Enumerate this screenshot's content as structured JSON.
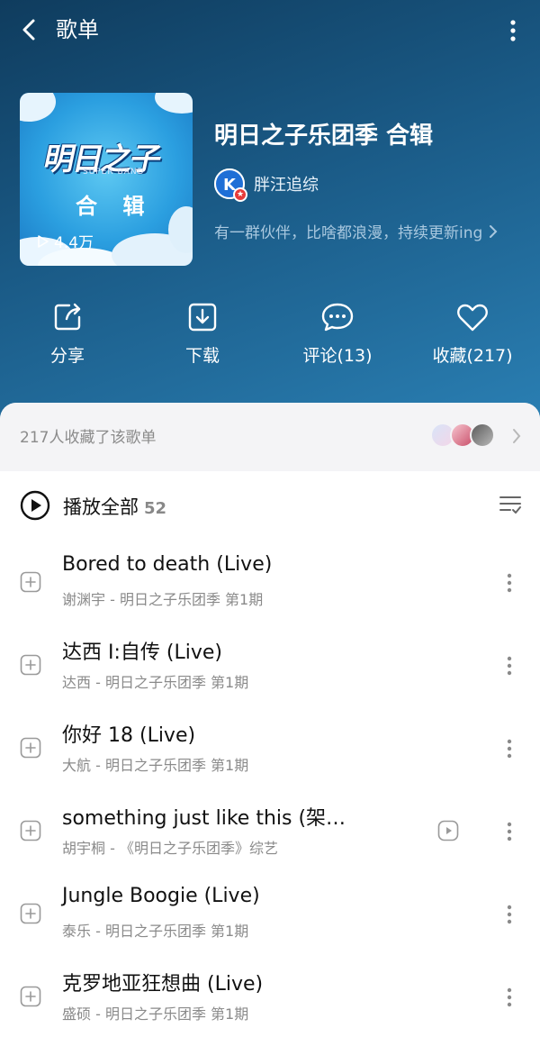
{
  "topbar": {
    "title": "歌单"
  },
  "playlist": {
    "title": "明日之子乐团季 合辑",
    "cover": {
      "logo_text": "明日之子",
      "sub_text": "SUPER BAND",
      "label": "合 辑",
      "plays": "4.4万"
    },
    "creator": {
      "avatar_letter": "K",
      "name": "胖汪追综"
    },
    "description": "有一群伙伴，比啥都浪漫，持续更新ing"
  },
  "actions": [
    {
      "id": "share",
      "label": "分享",
      "icon": "share-icon"
    },
    {
      "id": "download",
      "label": "下载",
      "icon": "download-icon"
    },
    {
      "id": "comment",
      "label": "评论(13)",
      "icon": "comment-icon"
    },
    {
      "id": "favorite",
      "label": "收藏(217)",
      "icon": "heart-icon"
    }
  ],
  "collectors": {
    "text": "217人收藏了该歌单"
  },
  "play_all": {
    "label": "播放全部",
    "count": "52"
  },
  "songs": [
    {
      "title": "Bored to death (Live)",
      "subtitle": "谢渊宇 - 明日之子乐团季 第1期",
      "has_video": false
    },
    {
      "title": "达西 I:自传 (Live)",
      "subtitle": "达西 - 明日之子乐团季 第1期",
      "has_video": false
    },
    {
      "title": "你好 18 (Live)",
      "subtitle": "大航 - 明日之子乐团季 第1期",
      "has_video": false
    },
    {
      "title": "something just like this (架…",
      "subtitle": "胡宇桐 - 《明日之子乐团季》综艺",
      "has_video": true
    },
    {
      "title": "Jungle Boogie (Live)",
      "subtitle": "泰乐 - 明日之子乐团季 第1期",
      "has_video": false
    },
    {
      "title": "克罗地亚狂想曲 (Live)",
      "subtitle": "盛硕 - 明日之子乐团季 第1期",
      "has_video": false
    }
  ],
  "colors": {
    "header_top": "#0f3c5e",
    "header_bottom": "#2a7fb3",
    "accent": "#1f6fd6"
  }
}
